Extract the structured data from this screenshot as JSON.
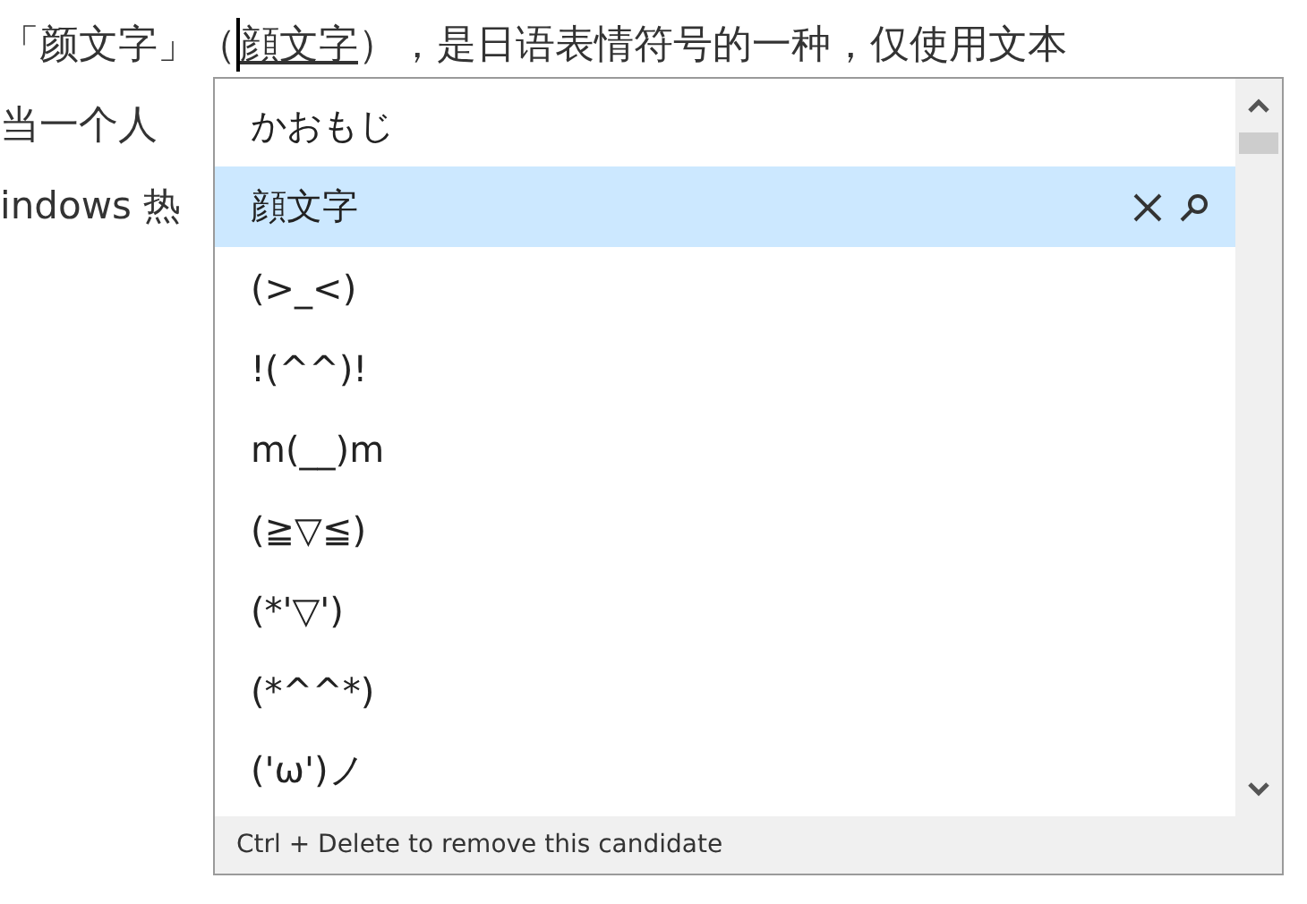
{
  "document": {
    "line_1": {
      "before": "「颜文字」（",
      "composition": "顔文字",
      "after": "），是日语表情符号的一种，仅使用文本"
    },
    "line_2": "当一个人",
    "line_3": "indows 热"
  },
  "candidate_window": {
    "candidates": [
      {
        "text": "かおもじ",
        "selected": false
      },
      {
        "text": "顔文字",
        "selected": true
      },
      {
        "text": "(>_<)",
        "selected": false
      },
      {
        "text": "!(^^)!",
        "selected": false
      },
      {
        "text": "m(__)m",
        "selected": false
      },
      {
        "text": "(≧▽≦)",
        "selected": false
      },
      {
        "text": "(*'▽')",
        "selected": false
      },
      {
        "text": "(*^^*)",
        "selected": false
      },
      {
        "text": "('ω')ノ",
        "selected": false
      }
    ],
    "hint": "Ctrl + Delete to remove this candidate"
  }
}
